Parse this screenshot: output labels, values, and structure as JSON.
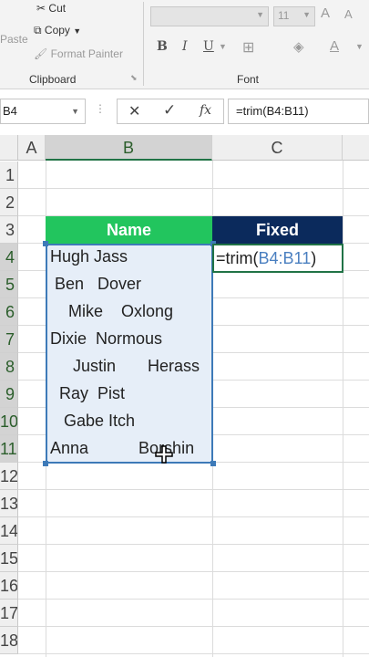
{
  "ribbon": {
    "paste_label": "Paste",
    "cut_label": "Cut",
    "copy_label": "Copy",
    "format_painter_label": "Format Painter",
    "clipboard_group": "Clipboard",
    "font_group": "Font",
    "font_size": "11",
    "bold": "B",
    "italic": "I",
    "underline": "U",
    "font_color_letter": "A",
    "increase_font": "A",
    "decrease_font": "A"
  },
  "formula_bar": {
    "name_box": "B4",
    "cancel": "✕",
    "enter": "✓",
    "fx": "fx",
    "formula": "=trim(B4:B11)"
  },
  "columns": [
    "A",
    "B",
    "C"
  ],
  "rows": [
    "1",
    "2",
    "3",
    "4",
    "5",
    "6",
    "7",
    "8",
    "9",
    "10",
    "11",
    "12",
    "13",
    "14",
    "15",
    "16",
    "17",
    "18"
  ],
  "table": {
    "header_name": "Name",
    "header_fixed": "Fixed",
    "names": [
      "Hugh Jass",
      " Ben   Dover",
      "    Mike    Oxlong",
      "Dixie  Normous",
      "     Justin       Herass",
      "  Ray  Pist",
      "   Gabe Itch",
      "Anna           Borshin"
    ]
  },
  "active_cell": {
    "prefix": "=trim(",
    "ref": "B4:B11",
    "suffix": ")"
  },
  "colors": {
    "name_header": "#22c55e",
    "fixed_header": "#0b2a5c",
    "selection": "#3d7ab8",
    "excel_green": "#217346"
  }
}
